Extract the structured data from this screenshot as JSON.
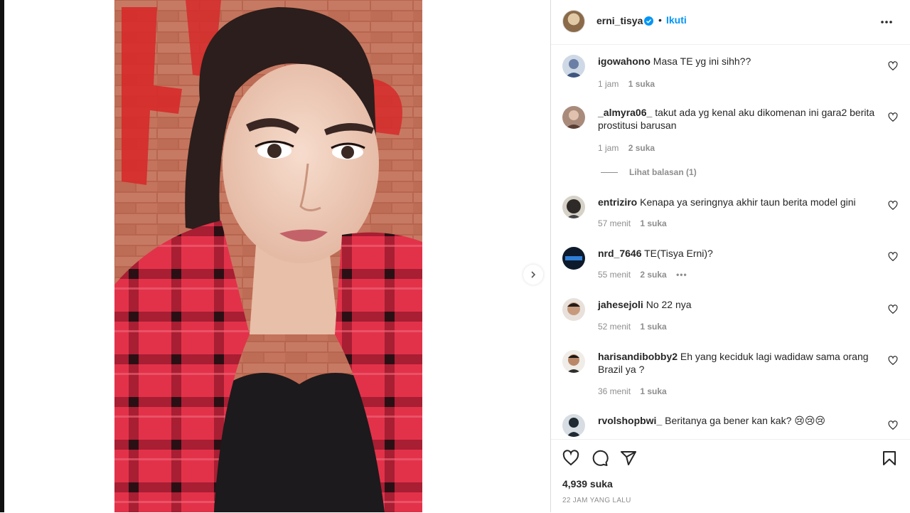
{
  "post": {
    "username": "erni_tisya",
    "follow_label": "Ikuti",
    "dot": "•",
    "likes": "4,939 suka",
    "timestamp": "22 JAM YANG LALU"
  },
  "comments": [
    {
      "user": "igowahono",
      "text": "Masa TE yg ini sihh??",
      "time": "1 jam",
      "likes": "1 suka"
    },
    {
      "user": "_almyra06_",
      "text": "takut ada yg kenal aku dikomenan ini gara2 berita prostitusi barusan",
      "time": "1 jam",
      "likes": "2 suka",
      "replies": "Lihat balasan (1)"
    },
    {
      "user": "entriziro",
      "text": "Kenapa ya seringnya akhir taun berita model gini",
      "time": "57 menit",
      "likes": "1 suka"
    },
    {
      "user": "nrd_7646",
      "text": "TE(Tisya Erni)?",
      "time": "55 menit",
      "likes": "2 suka",
      "more": "•••"
    },
    {
      "user": "jahesejoli",
      "text": "No 22 nya",
      "time": "52 menit",
      "likes": "1 suka"
    },
    {
      "user": "harisandibobby2",
      "text": "Eh yang keciduk lagi wadidaw sama orang Brazil ya ?",
      "time": "36 menit",
      "likes": "1 suka"
    },
    {
      "user": "rvolshopbwi_",
      "text": "Beritanya ga bener kan kak? 😢😢😢",
      "time": "",
      "likes": ""
    }
  ],
  "icons": {
    "like": "heart-icon",
    "comment": "comment-icon",
    "share": "send-icon",
    "save": "bookmark-icon",
    "more": "more-horizontal-icon",
    "next": "chevron-right-icon",
    "verified": "verified-badge-icon"
  },
  "colors": {
    "accent": "#0095f6",
    "text": "#262626",
    "muted": "#8e8e8e"
  }
}
